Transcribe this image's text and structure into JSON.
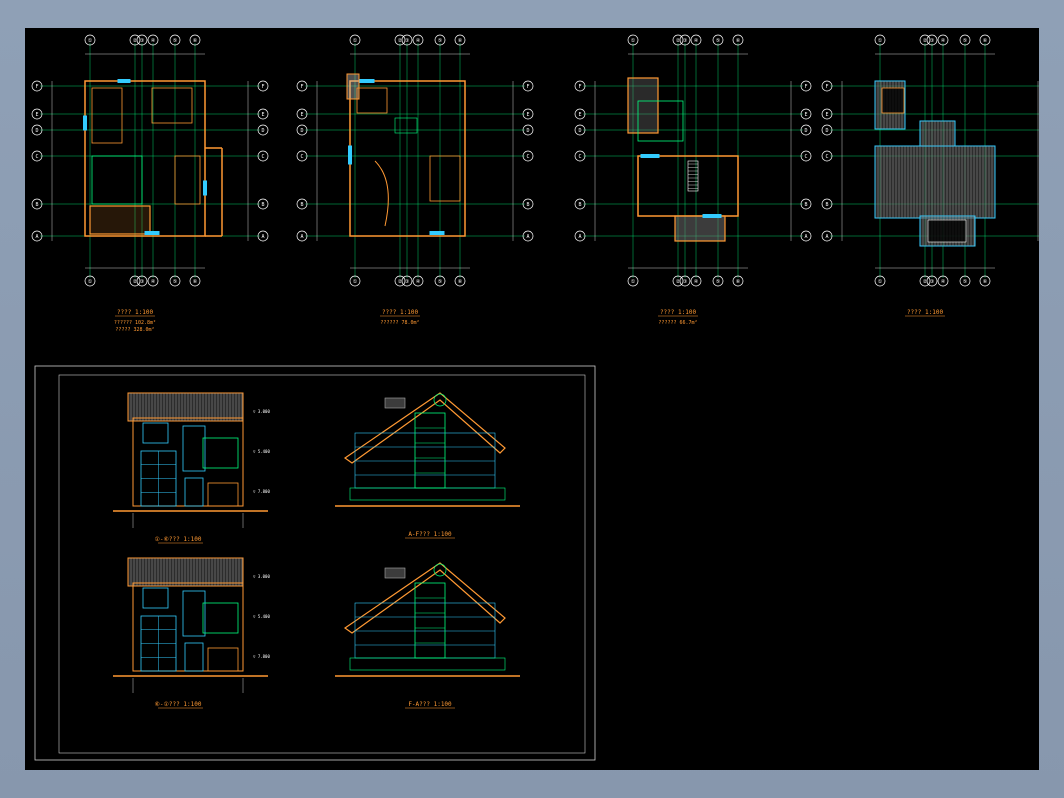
{
  "colors": {
    "background": "#000000",
    "frame": "#8c9bb0",
    "grid": "#00ff7f",
    "wall": "#ff9933",
    "window": "#33ccff",
    "axis_dim": "#ff3333",
    "text_white": "#ffffff",
    "title_orange": "#ff9933"
  },
  "plans": [
    {
      "title": "???? 1:100",
      "note1": "?????? 102.8m²",
      "note2": "????? 328.0m²"
    },
    {
      "title": "???? 1:100",
      "note1": "?????? 78.0m²",
      "note2": ""
    },
    {
      "title": "???? 1:100",
      "note1": "?????? 66.7m²",
      "note2": ""
    },
    {
      "title": "???? 1:100",
      "note1": "",
      "note2": ""
    }
  ],
  "elevations": [
    {
      "title": "①-⑥??? 1:100"
    },
    {
      "title": "A-F??? 1:100"
    },
    {
      "title": "⑥-①??? 1:100"
    },
    {
      "title": "F-A??? 1:100"
    }
  ],
  "axis_labels_top": [
    "①",
    "②",
    "③",
    "④",
    "⑤",
    "⑥"
  ],
  "axis_labels_side": [
    "F",
    "E",
    "D",
    "C",
    "B",
    "A"
  ]
}
